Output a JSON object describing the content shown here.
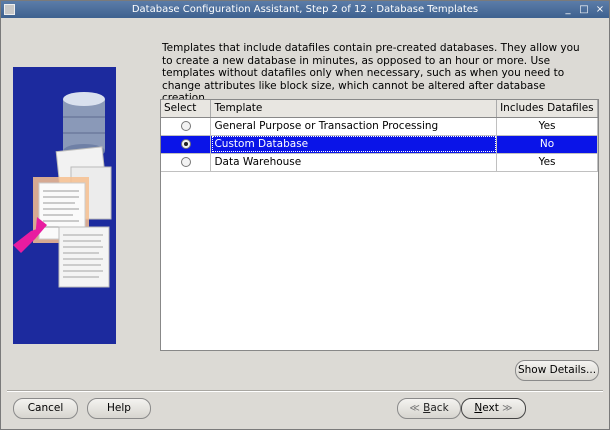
{
  "window": {
    "title": "Database Configuration Assistant, Step 2 of 12 : Database Templates",
    "controls": [
      "_",
      "□",
      "×"
    ]
  },
  "description": "Templates that include datafiles contain pre-created databases. They allow you to create a new database in minutes, as opposed to an hour or more. Use templates without datafiles only when necessary, such as when you need to change attributes like block size, which cannot be altered after database creation.",
  "table": {
    "headers": [
      "Select",
      "Template",
      "Includes Datafiles"
    ],
    "rows": [
      {
        "template": "General Purpose or Transaction Processing",
        "includes": "Yes",
        "selected": false
      },
      {
        "template": "Custom Database",
        "includes": "No",
        "selected": true
      },
      {
        "template": "Data Warehouse",
        "includes": "Yes",
        "selected": false
      }
    ]
  },
  "buttons": {
    "show_details": "Show Details...",
    "cancel": "Cancel",
    "help": "Help",
    "back_mnemonic": "B",
    "back_rest": "ack",
    "next_mnemonic": "N",
    "next_rest": "ext"
  },
  "colors": {
    "selection": "#0a14e8",
    "titlebar": "#3e618f",
    "art_background": "#1c2a9e",
    "arrow": "#e81ca0"
  }
}
